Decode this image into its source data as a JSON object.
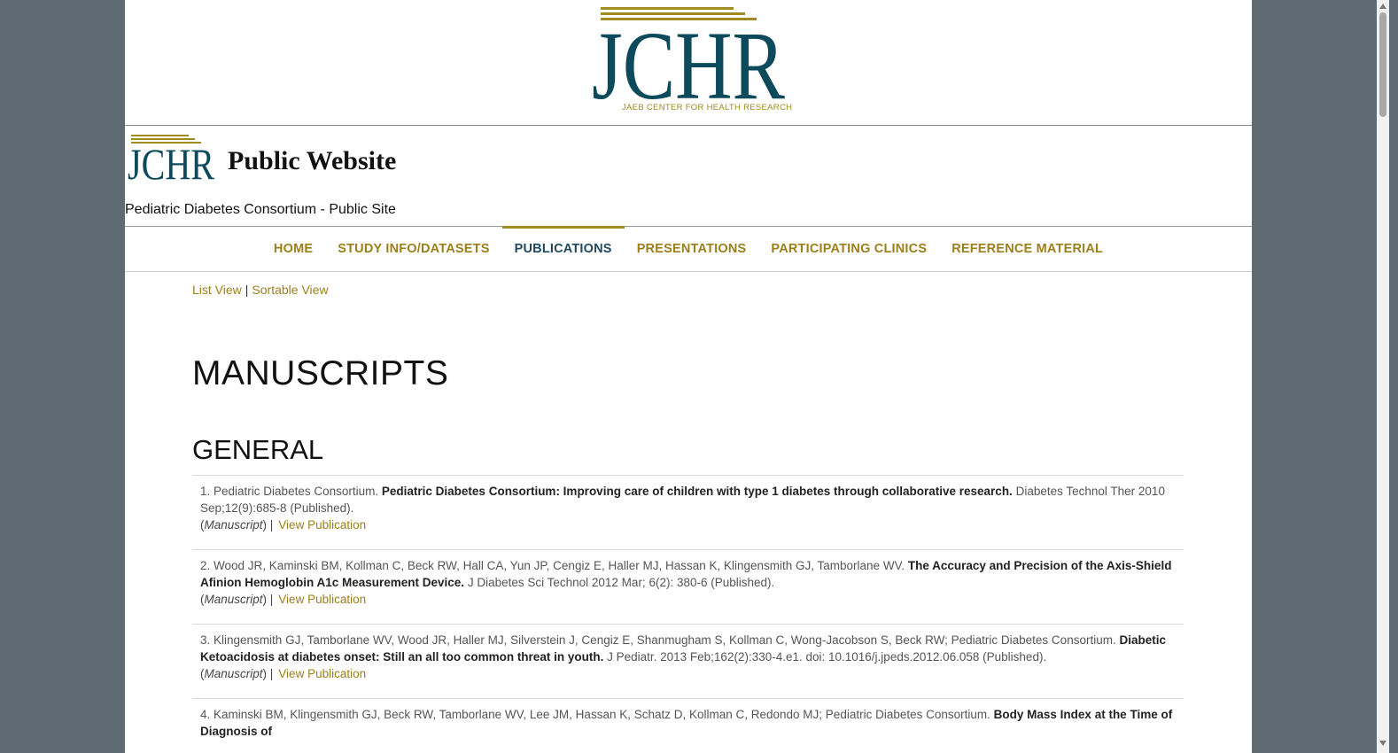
{
  "logo": {
    "big_text": "JCHR",
    "tagline": "JAEB CENTER FOR HEALTH RESEARCH",
    "small_text": "JCHR",
    "brand_color": "#0d4a5c",
    "gold_color": "#a08a22"
  },
  "site": {
    "title": "Public Website",
    "subtitle": "Pediatric Diabetes Consortium - Public Site"
  },
  "nav": {
    "items": [
      {
        "label": "HOME",
        "active": false
      },
      {
        "label": "STUDY INFO/DATASETS",
        "active": false
      },
      {
        "label": "PUBLICATIONS",
        "active": true
      },
      {
        "label": "PRESENTATIONS",
        "active": false
      },
      {
        "label": "PARTICIPATING CLINICS",
        "active": false
      },
      {
        "label": "REFERENCE MATERIAL",
        "active": false
      }
    ]
  },
  "views": {
    "list": "List View",
    "separator": "|",
    "sortable": "Sortable View"
  },
  "headings": {
    "main": "MANUSCRIPTS",
    "section": "GENERAL"
  },
  "publications": [
    {
      "number": "1.",
      "authors": "Pediatric Diabetes Consortium.",
      "title": "Pediatric Diabetes Consortium: Improving care of children with type 1 diabetes through collaborative research.",
      "citation": "Diabetes Technol Ther 2010 Sep;12(9):685-8 (Published).",
      "type": "Manuscript",
      "link": "View Publication"
    },
    {
      "number": "2.",
      "authors": "Wood JR, Kaminski BM, Kollman C, Beck RW, Hall CA, Yun JP, Cengiz E, Haller MJ, Hassan K, Klingensmith GJ, Tamborlane WV.",
      "title": "The Accuracy and Precision of the Axis-Shield Afinion Hemoglobin A1c Measurement Device.",
      "citation": "J Diabetes Sci Technol 2012 Mar; 6(2): 380-6 (Published).",
      "type": "Manuscript",
      "link": "View Publication"
    },
    {
      "number": "3.",
      "authors": "Klingensmith GJ, Tamborlane WV, Wood JR, Haller MJ, Silverstein J, Cengiz E, Shanmugham S, Kollman C, Wong-Jacobson S, Beck RW; Pediatric Diabetes Consortium.",
      "title": "Diabetic Ketoacidosis at diabetes onset: Still an all too common threat in youth.",
      "citation": "J Pediatr. 2013 Feb;162(2):330-4.e1. doi: 10.1016/j.jpeds.2012.06.058 (Published).",
      "type": "Manuscript",
      "link": "View Publication"
    },
    {
      "number": "4.",
      "authors": "Kaminski BM, Klingensmith GJ, Beck RW, Tamborlane WV, Lee JM, Hassan K, Schatz D, Kollman C, Redondo MJ; Pediatric Diabetes Consortium.",
      "title": "Body Mass Index at the Time of Diagnosis of",
      "citation": "",
      "type": "",
      "link": ""
    }
  ]
}
